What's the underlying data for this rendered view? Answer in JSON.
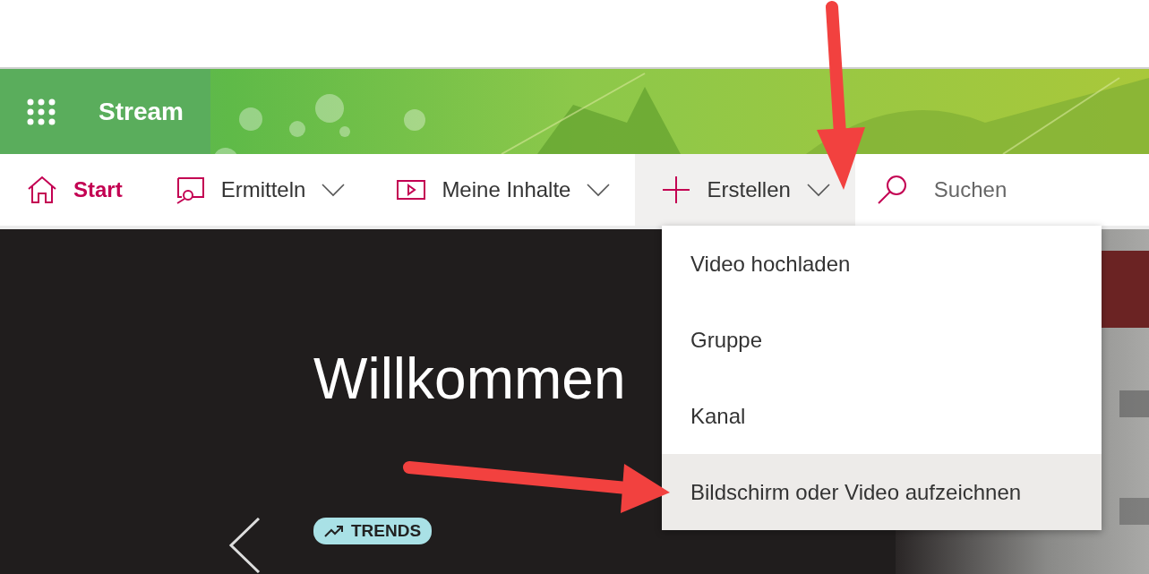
{
  "app_header": {
    "title": "Stream"
  },
  "nav": [
    {
      "kind": "home",
      "label": "Start",
      "selected": true
    },
    {
      "kind": "discover",
      "label": "Ermitteln",
      "selected": false,
      "expanded": false
    },
    {
      "kind": "content",
      "label": "Meine Inhalte",
      "selected": false,
      "expanded": false
    },
    {
      "kind": "create",
      "label": "Erstellen",
      "selected": false,
      "expanded": true
    }
  ],
  "search": {
    "placeholder": "Suchen"
  },
  "create_menu": {
    "items": [
      {
        "label": "Video hochladen",
        "selected": false
      },
      {
        "label": "Gruppe",
        "selected": false
      },
      {
        "label": "Kanal",
        "selected": false
      },
      {
        "label": "Bildschirm oder Video aufzeichnen",
        "selected": true
      }
    ]
  },
  "hero": {
    "heading": "Willkommen",
    "badge": "TRENDS"
  }
}
